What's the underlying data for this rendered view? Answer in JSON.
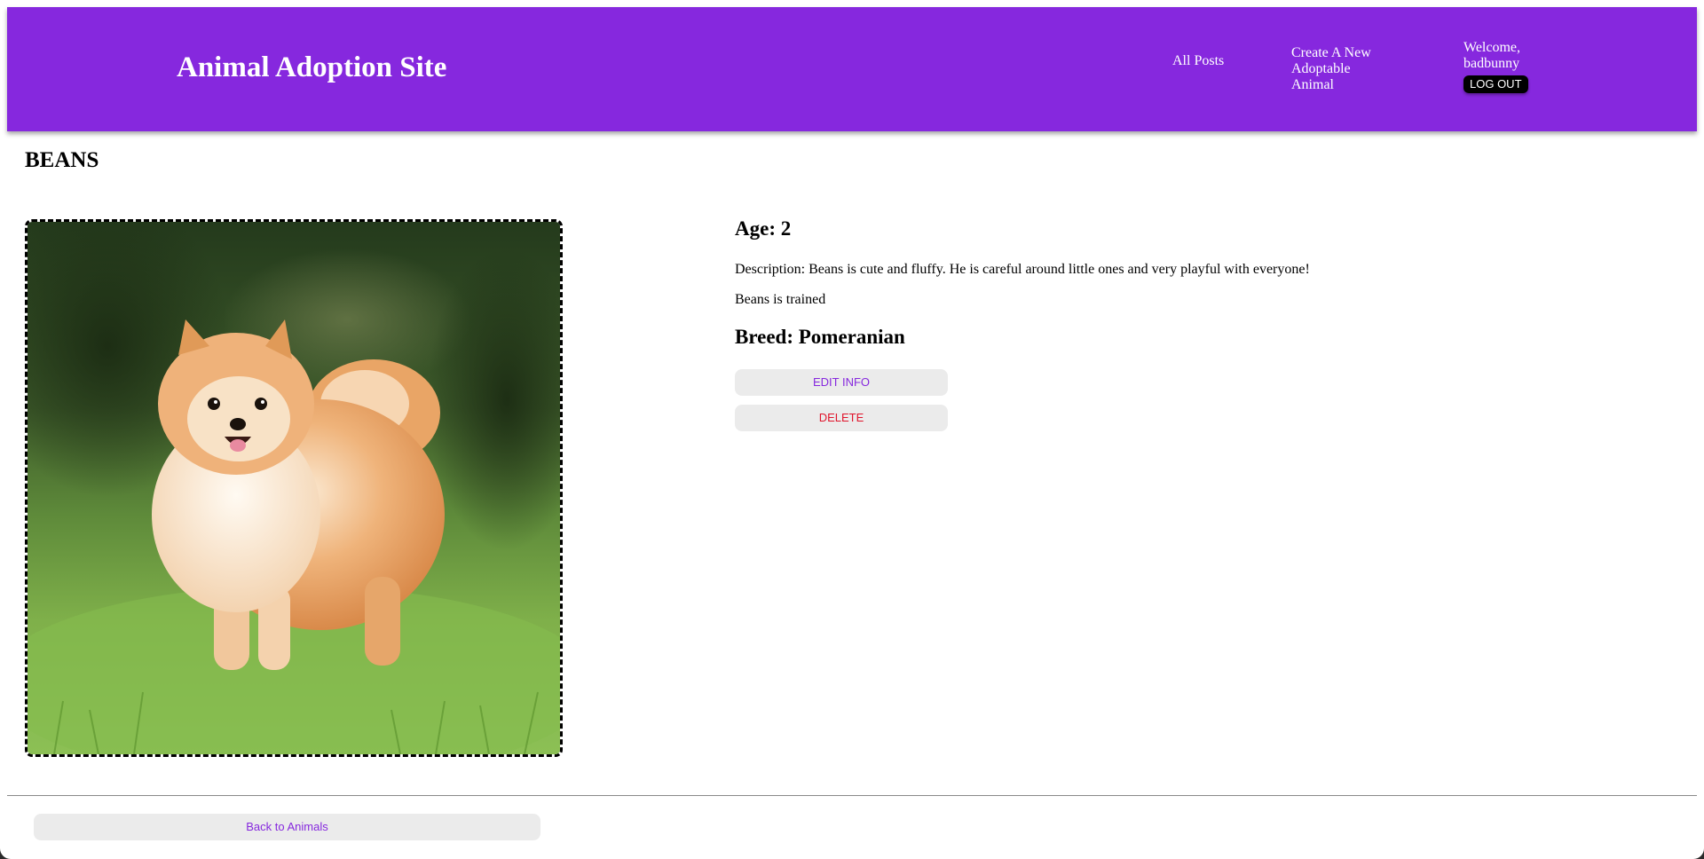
{
  "header": {
    "site_title": "Animal Adoption Site",
    "nav": {
      "all_posts": "All Posts",
      "create_new": "Create A New Adoptable Animal"
    },
    "welcome": "Welcome, badbunny",
    "logout_label": "LOG OUT"
  },
  "animal": {
    "name": "BEANS",
    "age_text": "Age: 2",
    "description_text": "Description: Beans is cute and fluffy. He is careful around little ones and very playful with everyone!",
    "trained_text": "Beans is trained",
    "breed_text": "Breed: Pomeranian",
    "photo_alt": "Pomeranian dog standing on grass"
  },
  "actions": {
    "edit_label": "EDIT INFO",
    "delete_label": "DELETE",
    "back_label": "Back to Animals"
  },
  "colors": {
    "header_purple": "#8628de",
    "delete_red": "#e0142c",
    "button_gray": "#ebebeb"
  },
  "icons": {
    "photo": "dog-photo"
  }
}
